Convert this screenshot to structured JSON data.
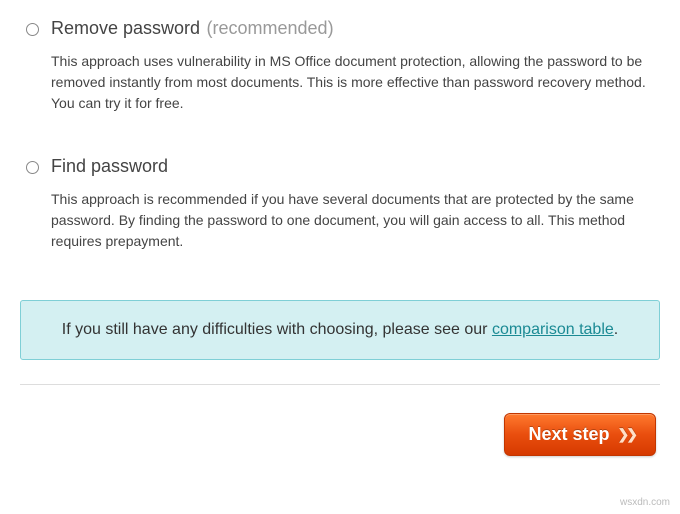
{
  "options": [
    {
      "title": "Remove password",
      "tag": "(recommended)",
      "desc": "This approach uses vulnerability in MS Office document protection, allowing the password to be removed instantly from most documents. This is more effective than password recovery method. You can try it for free."
    },
    {
      "title": "Find password",
      "tag": "",
      "desc": "This approach is recommended if you have several documents that are protected by the same password. By finding the password to one document, you will gain access to all. This method requires prepayment."
    }
  ],
  "info": {
    "prefix": "If you still have any difficulties with choosing, please see our ",
    "link_text": "comparison table",
    "suffix": "."
  },
  "button": {
    "label": "Next step"
  },
  "watermark": "wsxdn.com"
}
